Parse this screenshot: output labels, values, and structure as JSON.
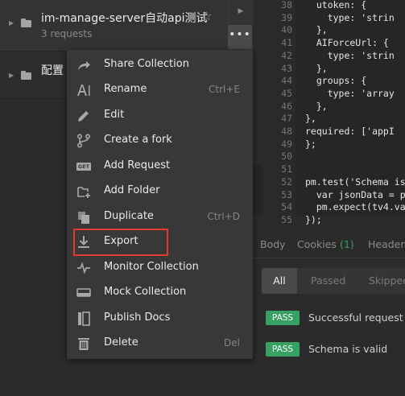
{
  "collections": [
    {
      "name": "im-manage-server自动api测试",
      "sub": "3 requests"
    },
    {
      "name": "配置"
    }
  ],
  "icons": {
    "star": "star-icon",
    "more": "more-icon",
    "expand": "chevron-right-icon"
  },
  "menu": [
    {
      "label": "Share Collection",
      "shortcut": "",
      "icon": "share-icon"
    },
    {
      "label": "Rename",
      "shortcut": "Ctrl+E",
      "icon": "rename-icon"
    },
    {
      "label": "Edit",
      "shortcut": "",
      "icon": "pencil-icon"
    },
    {
      "label": "Create a fork",
      "shortcut": "",
      "icon": "fork-icon"
    },
    {
      "label": "Add Request",
      "shortcut": "",
      "icon": "get-request-icon",
      "icon_text": "GET"
    },
    {
      "label": "Add Folder",
      "shortcut": "",
      "icon": "add-folder-icon"
    },
    {
      "label": "Duplicate",
      "shortcut": "Ctrl+D",
      "icon": "duplicate-icon"
    },
    {
      "label": "Export",
      "shortcut": "",
      "icon": "export-icon"
    },
    {
      "label": "Monitor Collection",
      "shortcut": "",
      "icon": "monitor-icon"
    },
    {
      "label": "Mock Collection",
      "shortcut": "",
      "icon": "mock-icon"
    },
    {
      "label": "Publish Docs",
      "shortcut": "",
      "icon": "docs-icon"
    },
    {
      "label": "Delete",
      "shortcut": "Del",
      "icon": "trash-icon"
    }
  ],
  "code_lines": [
    {
      "n": "38",
      "text": "  utoken: {"
    },
    {
      "n": "39",
      "text": "    type: 'strin"
    },
    {
      "n": "40",
      "text": "  },"
    },
    {
      "n": "41",
      "text": "  AIForceUrl: {"
    },
    {
      "n": "42",
      "text": "    type: 'strin"
    },
    {
      "n": "43",
      "text": "  },"
    },
    {
      "n": "44",
      "text": "  groups: {"
    },
    {
      "n": "45",
      "text": "    type: 'array"
    },
    {
      "n": "46",
      "text": "  },"
    },
    {
      "n": "47",
      "text": "},"
    },
    {
      "n": "48",
      "text": "required: ['appI"
    },
    {
      "n": "49",
      "text": "};"
    },
    {
      "n": "50",
      "text": ""
    },
    {
      "n": "51",
      "text": ""
    },
    {
      "n": "52",
      "text": "pm.test('Schema is"
    },
    {
      "n": "53",
      "text": "  var jsonData = p"
    },
    {
      "n": "54",
      "text": "  pm.expect(tv4.va"
    },
    {
      "n": "55",
      "text": "});"
    }
  ],
  "response_tabs": {
    "body": "Body",
    "cookies": "Cookies",
    "cookies_count": "(1)",
    "headers": "Headers"
  },
  "filters": [
    "All",
    "Passed",
    "Skipped"
  ],
  "tests": [
    {
      "status": "PASS",
      "name": "Successful request"
    },
    {
      "status": "PASS",
      "name": "Schema is valid"
    }
  ],
  "colors": {
    "pass": "#37a164",
    "highlight": "#e03b2c",
    "menu_bg": "#383838"
  }
}
